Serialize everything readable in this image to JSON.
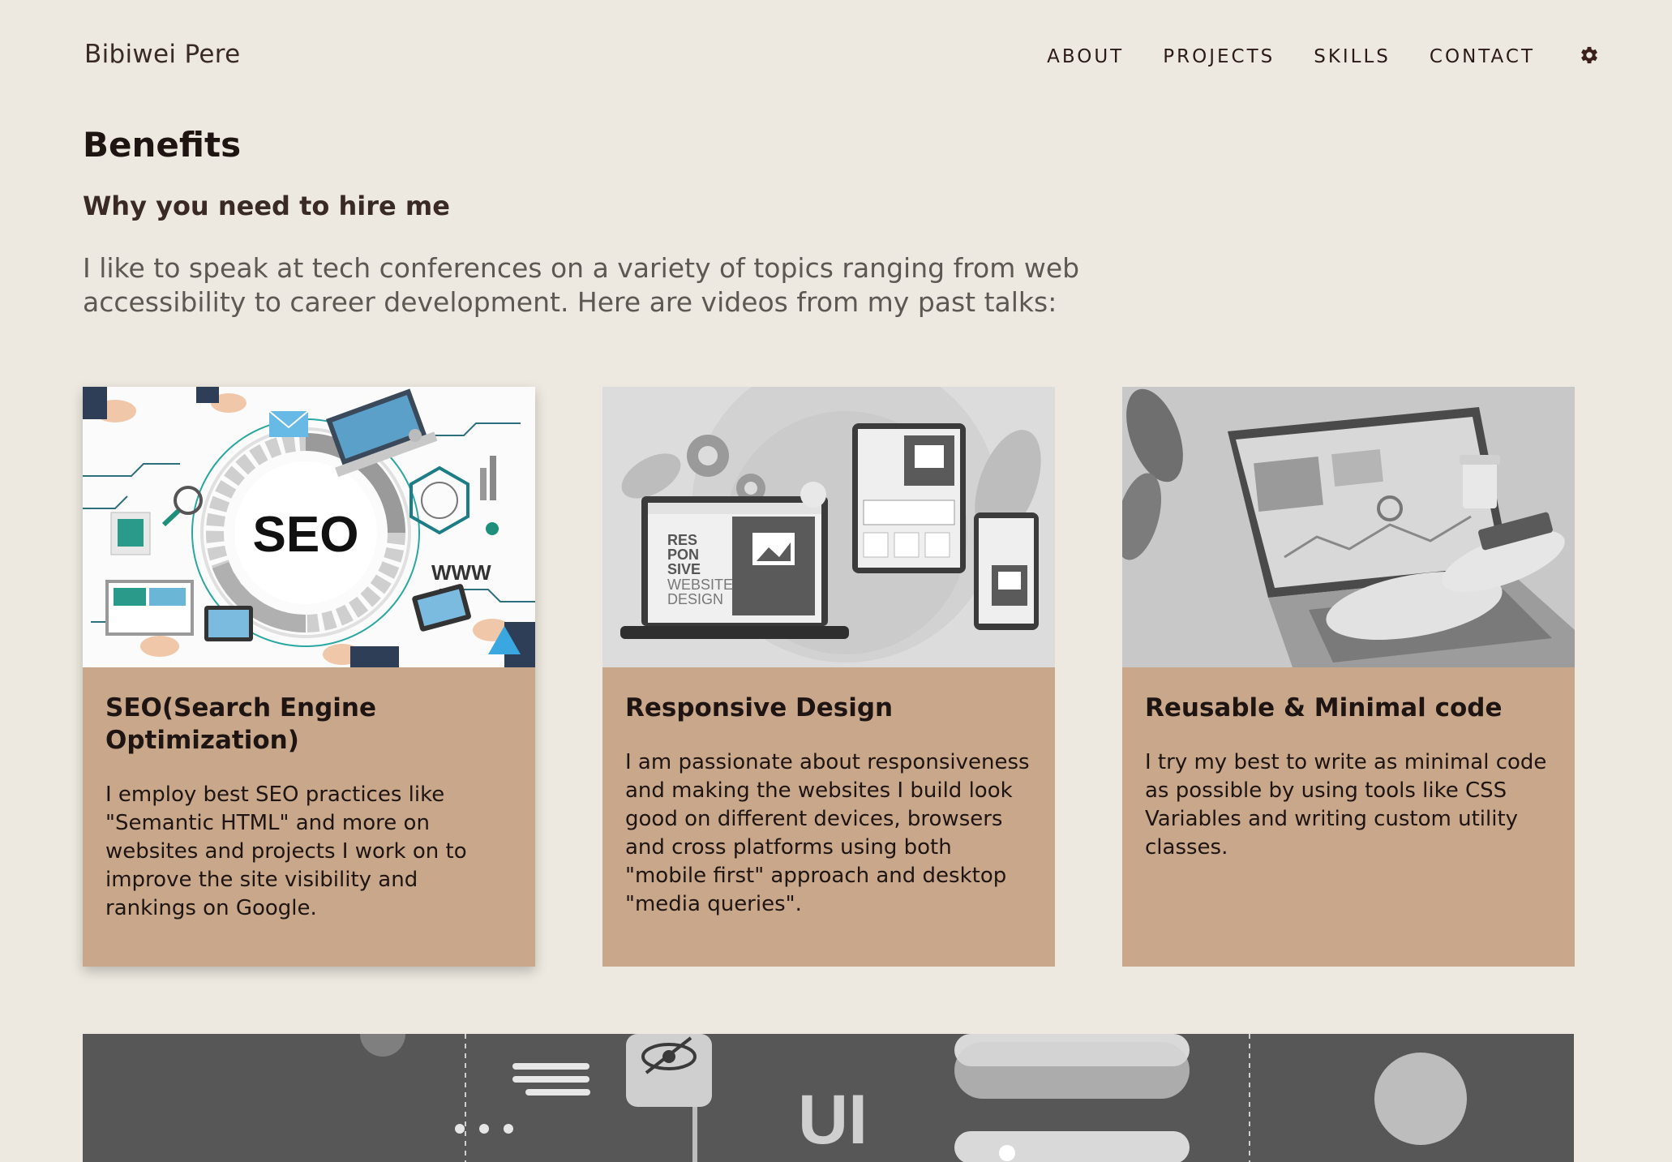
{
  "header": {
    "brand": "Bibiwei Pere",
    "nav": [
      "ABOUT",
      "PROJECTS",
      "SKILLS",
      "CONTACT"
    ],
    "settings_icon": "gear-icon"
  },
  "intro": {
    "title": "Benefits",
    "subtitle": "Why you need to hire me",
    "description": "I like to speak at tech conferences on a variety of topics ranging from web accessibility to career development. Here are videos from my past talks:"
  },
  "cards": [
    {
      "title": "SEO(Search Engine Optimization)",
      "text": "I employ best SEO practices like \"Semantic HTML\" and more on websites and projects I work on to improve the site visibility and rankings on Google.",
      "image_text": [
        "SEO",
        "WWW"
      ]
    },
    {
      "title": "Responsive Design",
      "text": "I am passionate about responsiveness and making the websites I build look good on different devices, browsers and cross platforms using both \"mobile first\" approach and desktop \"media queries\".",
      "image_text": [
        "RES",
        "PON",
        "SIVE",
        "WEBSITE",
        "DESIGN"
      ]
    },
    {
      "title": "Reusable & Minimal code",
      "text": "I try my best to write as minimal code as possible by using tools like CSS Variables and writing custom utility classes."
    }
  ],
  "banner": {
    "image_text": "UI"
  },
  "colors": {
    "background": "#ede9e0",
    "card": "#c9a78b",
    "text_dark": "#1e1412",
    "muted": "#5e5854"
  }
}
